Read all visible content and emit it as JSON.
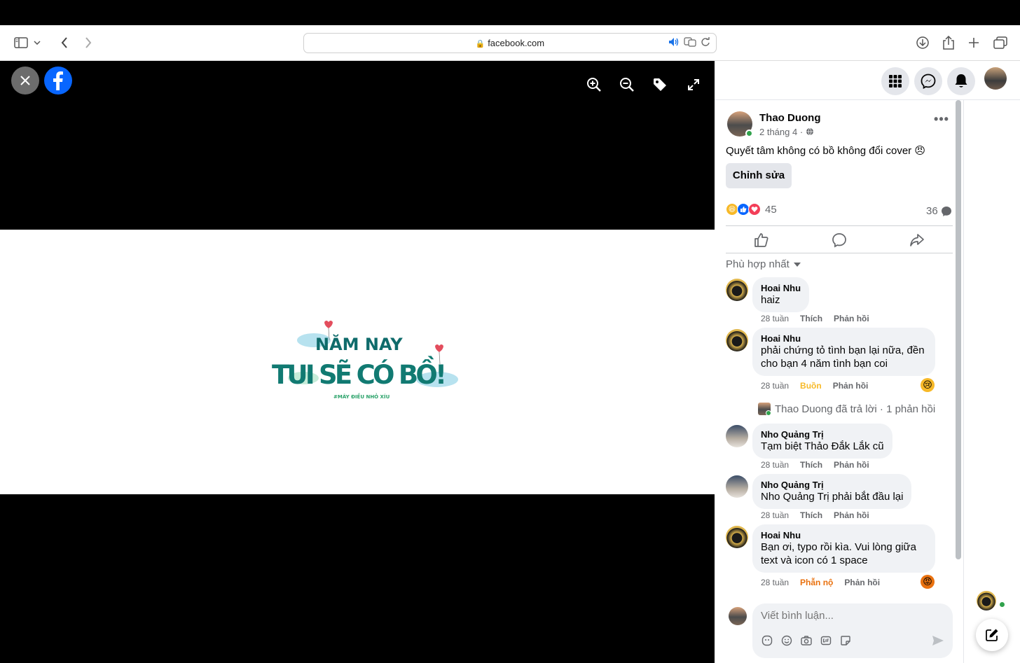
{
  "browser": {
    "url": "facebook.com"
  },
  "post": {
    "author": "Thao Duong",
    "time": "2 tháng 4 ·",
    "text": "Quyết tâm không có bồ không đổi cover 😠",
    "edit_label": "Chỉnh sửa",
    "reaction_count": "45",
    "comment_count": "36"
  },
  "photo": {
    "line1": "NĂM NAY",
    "line2": "TUI SẼ CÓ BỒ!",
    "tag": "#MÂY ĐIỀU NHỎ XÍU"
  },
  "comments_sort": "Phù hợp nhất",
  "comments": [
    {
      "name": "Hoai Nhu",
      "text": "haiz",
      "time": "28 tuần",
      "like": "Thích",
      "reply": "Phản hồi"
    },
    {
      "name": "Hoai Nhu",
      "text_line1": "phải chứng tỏ tình bạn lại nữa, đền",
      "text_line2": "cho bạn 4 năm tình bạn coi",
      "time": "28 tuần",
      "like": "Buồn",
      "reply": "Phản hồi"
    },
    {
      "name": "Nho Quảng Trị",
      "text": "Tạm biệt Thảo Đắk Lắk cũ",
      "time": "28 tuần",
      "like": "Thích",
      "reply": "Phản hồi"
    },
    {
      "name": "Nho Quảng Trị",
      "text": "Nho Quảng Trị phải bắt đầu lại",
      "time": "28 tuần",
      "like": "Thích",
      "reply": "Phản hồi"
    },
    {
      "name": "Hoai Nhu",
      "text_line1": "Bạn ơi, typo rồi kìa. Vui lòng giữa",
      "text_line2": "text và icon có 1 space",
      "time": "28 tuần",
      "like": "Phẫn nộ",
      "reply": "Phản hồi"
    }
  ],
  "reply_summary": "Thao Duong đã trả lời · 1 phản hồi",
  "composer": {
    "placeholder": "Viết bình luận..."
  },
  "colors": {
    "facebook_blue": "#0866ff",
    "sad_yellow": "#f7b928",
    "angry_orange": "#e9710f",
    "online_green": "#31a24c"
  }
}
